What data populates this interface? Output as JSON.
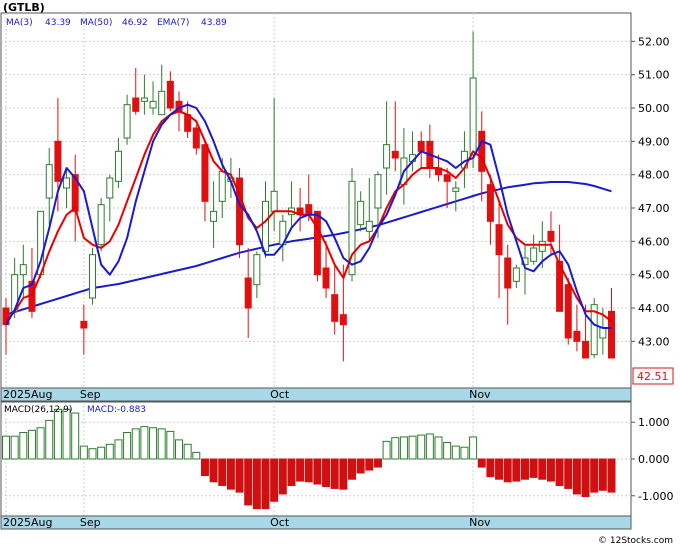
{
  "ticker_label": "(GTLB)",
  "price_legend": {
    "ma3": "MA(3)",
    "ma3_val": "43.39",
    "ma50": "MA(50)",
    "ma50_val": "46.92",
    "ema7": "EMA(7)",
    "ema7_val": "43.89"
  },
  "macd_legend": {
    "name": "MACD(26,12,9)",
    "value": "MACD:-0.883"
  },
  "last_price": "42.51",
  "watermark": "© 12Stocks.com",
  "colors": {
    "up_candle": "#2e7d2e",
    "down_candle": "#e01010",
    "ma_blue": "#1a1ad0",
    "ema_red": "#e80000",
    "axis_band": "#a8d8e8",
    "grid": "#cfcfcf",
    "macd_pos": "#2e7d2e",
    "macd_neg": "#d01010"
  },
  "chart_data": [
    {
      "type": "candlestick",
      "y_ticks": [
        43.0,
        44.0,
        45.0,
        46.0,
        47.0,
        48.0,
        49.0,
        50.0,
        51.0,
        52.0
      ],
      "y_tick_labels": [
        "43.00",
        "44.00",
        "45.00",
        "46.00",
        "47.00",
        "48.00",
        "49.00",
        "50.00",
        "51.00",
        "52.00"
      ],
      "ylim": [
        41.6,
        52.85
      ],
      "x_labels": [
        {
          "label": "2025Aug",
          "index": 0
        },
        {
          "label": "Sep",
          "index": 9
        },
        {
          "label": "Oct",
          "index": 31
        },
        {
          "label": "Nov",
          "index": 54
        }
      ],
      "grid": true,
      "candles": [
        [
          44.0,
          44.3,
          42.6,
          43.5
        ],
        [
          43.9,
          45.5,
          43.7,
          45.0
        ],
        [
          45.0,
          45.9,
          44.3,
          45.3
        ],
        [
          44.8,
          45.8,
          43.7,
          43.9
        ],
        [
          45.0,
          46.9,
          44.9,
          46.9
        ],
        [
          47.3,
          48.8,
          46.5,
          48.3
        ],
        [
          49.0,
          50.3,
          46.9,
          47.8
        ],
        [
          47.6,
          48.2,
          47.0,
          47.9
        ],
        [
          48.0,
          48.6,
          46.0,
          46.9
        ],
        [
          43.6,
          44.1,
          42.6,
          43.4
        ],
        [
          44.3,
          45.8,
          44.1,
          45.6
        ],
        [
          45.9,
          47.3,
          45.7,
          47.1
        ],
        [
          47.3,
          48.0,
          46.6,
          47.9
        ],
        [
          47.8,
          49.1,
          47.6,
          48.7
        ],
        [
          49.1,
          50.4,
          48.9,
          50.1
        ],
        [
          50.3,
          51.2,
          49.8,
          49.9
        ],
        [
          50.2,
          51.0,
          49.8,
          50.3
        ],
        [
          50.0,
          50.8,
          49.8,
          50.2
        ],
        [
          49.8,
          51.3,
          49.8,
          50.5
        ],
        [
          50.8,
          51.1,
          49.9,
          50.0
        ],
        [
          50.2,
          50.5,
          49.3,
          49.9
        ],
        [
          49.8,
          50.2,
          49.1,
          49.3
        ],
        [
          49.4,
          49.5,
          48.6,
          48.8
        ],
        [
          48.9,
          49.0,
          46.6,
          47.2
        ],
        [
          46.6,
          47.8,
          45.8,
          46.9
        ],
        [
          47.2,
          48.5,
          46.7,
          48.1
        ],
        [
          47.8,
          48.5,
          47.3,
          47.9
        ],
        [
          47.9,
          48.2,
          45.5,
          45.9
        ],
        [
          44.9,
          45.8,
          43.1,
          44.0
        ],
        [
          44.7,
          45.7,
          44.3,
          45.6
        ],
        [
          45.7,
          47.8,
          45.5,
          47.2
        ],
        [
          46.9,
          50.3,
          46.3,
          47.5
        ],
        [
          45.9,
          46.8,
          45.4,
          46.6
        ],
        [
          46.8,
          47.8,
          46.4,
          47.0
        ],
        [
          47.0,
          47.6,
          46.3,
          46.8
        ],
        [
          47.1,
          48.0,
          46.6,
          46.8
        ],
        [
          46.9,
          46.9,
          44.8,
          45.0
        ],
        [
          45.2,
          46.0,
          44.3,
          44.6
        ],
        [
          44.4,
          45.3,
          43.2,
          43.6
        ],
        [
          43.8,
          45.3,
          42.4,
          43.5
        ],
        [
          45.0,
          48.2,
          44.8,
          47.8
        ],
        [
          46.5,
          47.5,
          46.3,
          47.2
        ],
        [
          46.3,
          47.9,
          46.0,
          46.6
        ],
        [
          47.0,
          48.1,
          46.1,
          48.0
        ],
        [
          48.2,
          50.2,
          47.4,
          48.9
        ],
        [
          48.7,
          50.2,
          48.1,
          48.5
        ],
        [
          47.7,
          49.4,
          47.1,
          48.5
        ],
        [
          48.4,
          49.3,
          48.1,
          48.6
        ],
        [
          49.0,
          49.3,
          48.2,
          48.7
        ],
        [
          49.0,
          49.5,
          47.9,
          48.2
        ],
        [
          48.2,
          48.6,
          47.8,
          48.0
        ],
        [
          48.0,
          48.2,
          47.0,
          47.8
        ],
        [
          47.5,
          47.8,
          46.9,
          47.6
        ],
        [
          48.2,
          49.3,
          47.6,
          48.7
        ],
        [
          48.6,
          52.3,
          48.2,
          50.9
        ],
        [
          49.3,
          49.9,
          47.2,
          48.1
        ],
        [
          47.7,
          48.0,
          45.9,
          46.6
        ],
        [
          46.5,
          47.2,
          44.3,
          45.6
        ],
        [
          45.5,
          45.9,
          43.5,
          44.6
        ],
        [
          44.8,
          45.3,
          44.6,
          45.2
        ],
        [
          45.3,
          45.9,
          44.4,
          45.5
        ],
        [
          45.4,
          46.2,
          45.3,
          45.8
        ],
        [
          45.7,
          46.6,
          45.2,
          46.0
        ],
        [
          46.3,
          46.9,
          45.6,
          46.0
        ],
        [
          45.4,
          46.5,
          44.2,
          43.9
        ],
        [
          44.7,
          44.9,
          42.9,
          43.1
        ],
        [
          43.3,
          44.1,
          42.7,
          43.0
        ],
        [
          43.0,
          44.1,
          42.6,
          42.5
        ],
        [
          42.6,
          44.3,
          42.5,
          44.1
        ],
        [
          43.1,
          44.0,
          42.6,
          43.4
        ],
        [
          43.9,
          44.6,
          42.6,
          42.5
        ]
      ],
      "ma3": [
        43.5,
        43.95,
        44.6,
        44.7,
        45.4,
        46.4,
        47.5,
        48.2,
        47.9,
        47.5,
        46.4,
        45.3,
        45.0,
        45.4,
        46.1,
        47.2,
        48.1,
        49.0,
        49.5,
        49.8,
        50.0,
        50.1,
        50.0,
        49.6,
        49.0,
        48.3,
        47.8,
        47.1,
        46.8,
        46.3,
        45.6,
        45.6,
        45.9,
        46.4,
        46.7,
        46.8,
        46.8,
        46.6,
        46.1,
        45.5,
        45.3,
        45.4,
        45.8,
        46.4,
        46.8,
        47.4,
        48.1,
        48.4,
        48.7,
        48.6,
        48.5,
        48.4,
        48.2,
        48.4,
        48.5,
        49.0,
        48.9,
        47.9,
        46.8,
        46.0,
        45.2,
        45.1,
        45.4,
        45.6,
        45.7,
        45.3,
        44.5,
        43.8,
        43.5,
        43.4,
        43.4
      ],
      "ma50": [
        43.8,
        43.88,
        43.96,
        44.04,
        44.12,
        44.2,
        44.28,
        44.36,
        44.44,
        44.52,
        44.6,
        44.64,
        44.68,
        44.72,
        44.78,
        44.84,
        44.9,
        44.96,
        45.02,
        45.08,
        45.14,
        45.2,
        45.26,
        45.34,
        45.42,
        45.5,
        45.58,
        45.66,
        45.72,
        45.78,
        45.84,
        45.9,
        45.95,
        46.0,
        46.04,
        46.08,
        46.12,
        46.16,
        46.2,
        46.25,
        46.3,
        46.36,
        46.42,
        46.48,
        46.56,
        46.64,
        46.72,
        46.8,
        46.88,
        46.96,
        47.04,
        47.12,
        47.2,
        47.28,
        47.36,
        47.44,
        47.5,
        47.56,
        47.62,
        47.66,
        47.7,
        47.74,
        47.76,
        47.78,
        47.78,
        47.78,
        47.75,
        47.72,
        47.66,
        47.58,
        47.5
      ],
      "ema7": [
        43.6,
        43.9,
        44.3,
        44.4,
        45.0,
        45.7,
        46.3,
        46.8,
        47.0,
        46.1,
        45.9,
        45.8,
        46.0,
        46.5,
        47.2,
        47.9,
        48.6,
        49.2,
        49.6,
        49.8,
        49.9,
        49.8,
        49.6,
        49.0,
        48.4,
        48.1,
        48.0,
        47.4,
        46.7,
        46.4,
        46.6,
        46.9,
        46.9,
        46.9,
        46.8,
        46.8,
        46.4,
        45.9,
        45.3,
        44.9,
        45.6,
        45.9,
        46.0,
        46.4,
        47.0,
        47.5,
        47.7,
        48.0,
        48.2,
        48.2,
        48.2,
        48.1,
        47.9,
        48.2,
        48.7,
        48.5,
        47.9,
        47.2,
        46.5,
        46.1,
        45.9,
        45.9,
        45.9,
        45.9,
        45.3,
        44.8,
        44.3,
        43.9,
        43.9,
        43.8,
        43.6
      ]
    },
    {
      "type": "bar",
      "title": "MACD(26,12,9)",
      "ylim": [
        -1.55,
        1.55
      ],
      "y_ticks": [
        1.0,
        0.0,
        -1.0
      ],
      "y_tick_labels": [
        "1.000",
        "0.000",
        "-1.000"
      ],
      "x_labels": [
        {
          "label": "2025Aug",
          "index": 0
        },
        {
          "label": "Sep",
          "index": 9
        },
        {
          "label": "Oct",
          "index": 31
        },
        {
          "label": "Nov",
          "index": 54
        }
      ],
      "values": [
        0.62,
        0.62,
        0.72,
        0.78,
        0.85,
        1.05,
        1.35,
        1.35,
        1.25,
        0.35,
        0.28,
        0.32,
        0.4,
        0.52,
        0.72,
        0.82,
        0.88,
        0.85,
        0.82,
        0.75,
        0.52,
        0.4,
        0.18,
        -0.45,
        -0.62,
        -0.72,
        -0.82,
        -0.9,
        -1.25,
        -1.35,
        -1.35,
        -1.15,
        -0.95,
        -0.72,
        -0.6,
        -0.62,
        -0.68,
        -0.75,
        -0.8,
        -0.82,
        -0.55,
        -0.38,
        -0.3,
        -0.22,
        0.48,
        0.58,
        0.6,
        0.62,
        0.65,
        0.68,
        0.6,
        0.45,
        0.35,
        0.32,
        0.6,
        -0.22,
        -0.48,
        -0.55,
        -0.62,
        -0.6,
        -0.55,
        -0.5,
        -0.55,
        -0.6,
        -0.72,
        -0.8,
        -0.95,
        -1.02,
        -0.9,
        -0.85,
        -0.9
      ]
    }
  ]
}
